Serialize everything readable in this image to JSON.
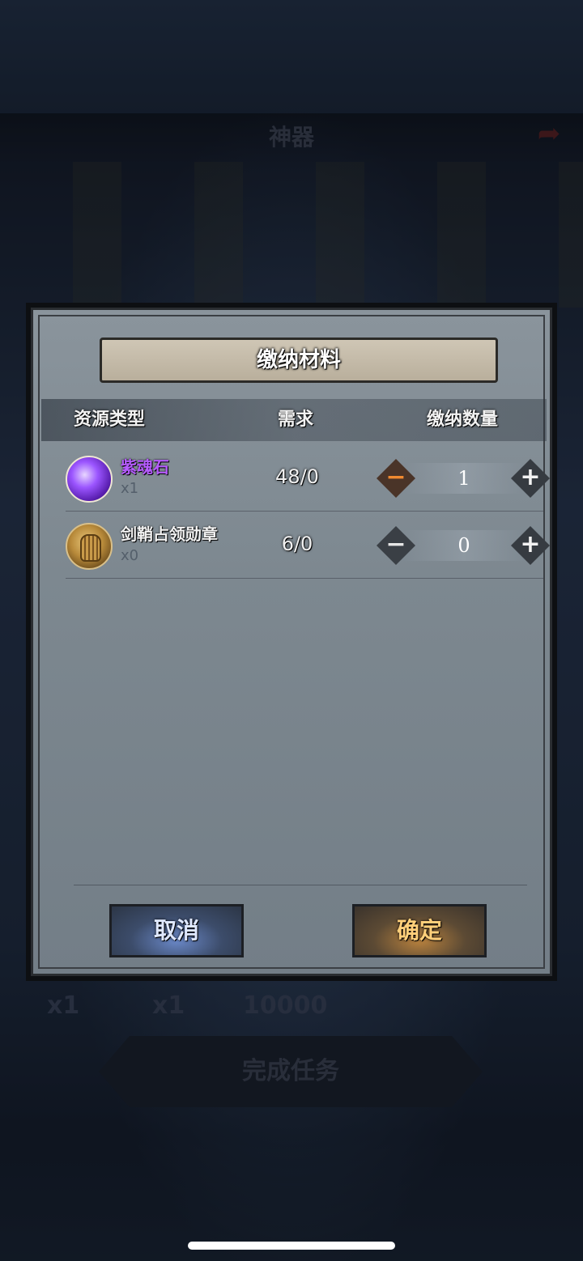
{
  "background": {
    "title": "神器",
    "reward_counts": [
      "x1",
      "x1",
      "10000"
    ],
    "complete_button": "完成任务"
  },
  "dialog": {
    "title": "缴纳材料",
    "headers": {
      "resource_type": "资源类型",
      "requirement": "需求",
      "submit_quantity": "缴纳数量"
    },
    "items": [
      {
        "name": "紫魂石",
        "name_color": "#b65cff",
        "owned": "x1",
        "requirement": "48/0",
        "quantity": "1",
        "icon": "purple-gem-icon"
      },
      {
        "name": "剑鞘占领勋章",
        "name_color": "#f2f2f2",
        "owned": "x0",
        "requirement": "6/0",
        "quantity": "0",
        "icon": "helmet-medal-icon"
      }
    ],
    "stepper": {
      "minus": "−",
      "plus": "+"
    },
    "cancel_label": "取消",
    "confirm_label": "确定"
  }
}
